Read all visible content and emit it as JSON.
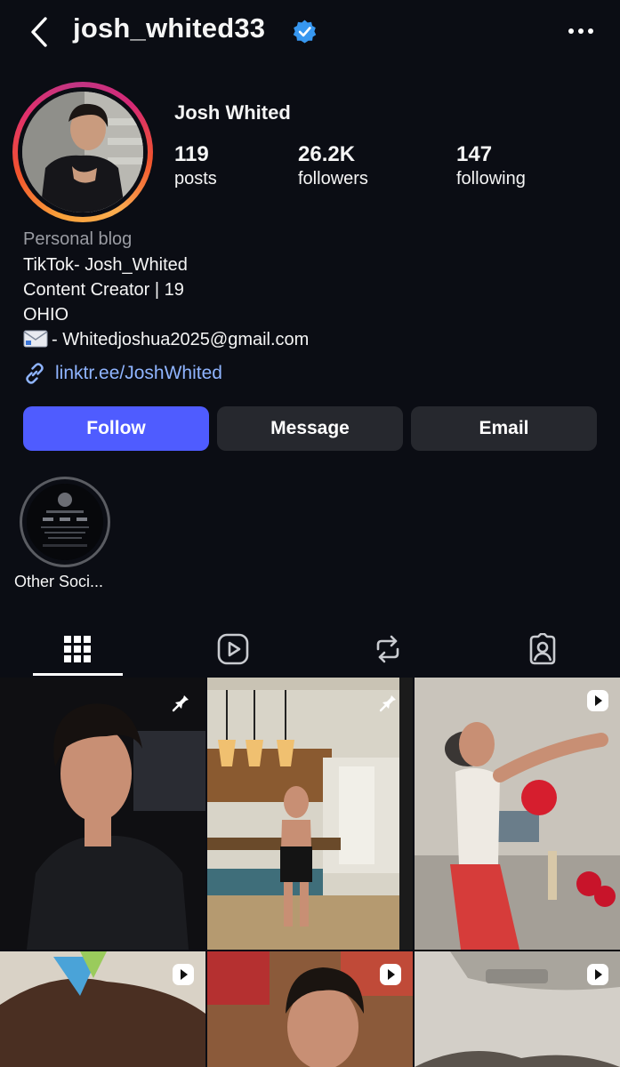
{
  "header": {
    "username": "josh_whited33"
  },
  "profile": {
    "display_name": "Josh Whited",
    "stats": [
      {
        "value": "119",
        "label": "posts"
      },
      {
        "value": "26.2K",
        "label": "followers"
      },
      {
        "value": "147",
        "label": "following"
      }
    ],
    "category": "Personal blog",
    "bio": [
      "TikTok- Josh_Whited",
      "Content Creator | 19",
      "OHIO"
    ],
    "email_line": "- Whitedjoshua2025@gmail.com",
    "link": "linktr.ee/JoshWhited"
  },
  "actions": {
    "follow": "Follow",
    "message": "Message",
    "email": "Email"
  },
  "highlights": [
    {
      "label": "Other Soci..."
    }
  ],
  "colors": {
    "accent": "#4f5cff",
    "link": "#8fb4ff",
    "verified": "#3797f0",
    "background": "#0b0d14"
  }
}
